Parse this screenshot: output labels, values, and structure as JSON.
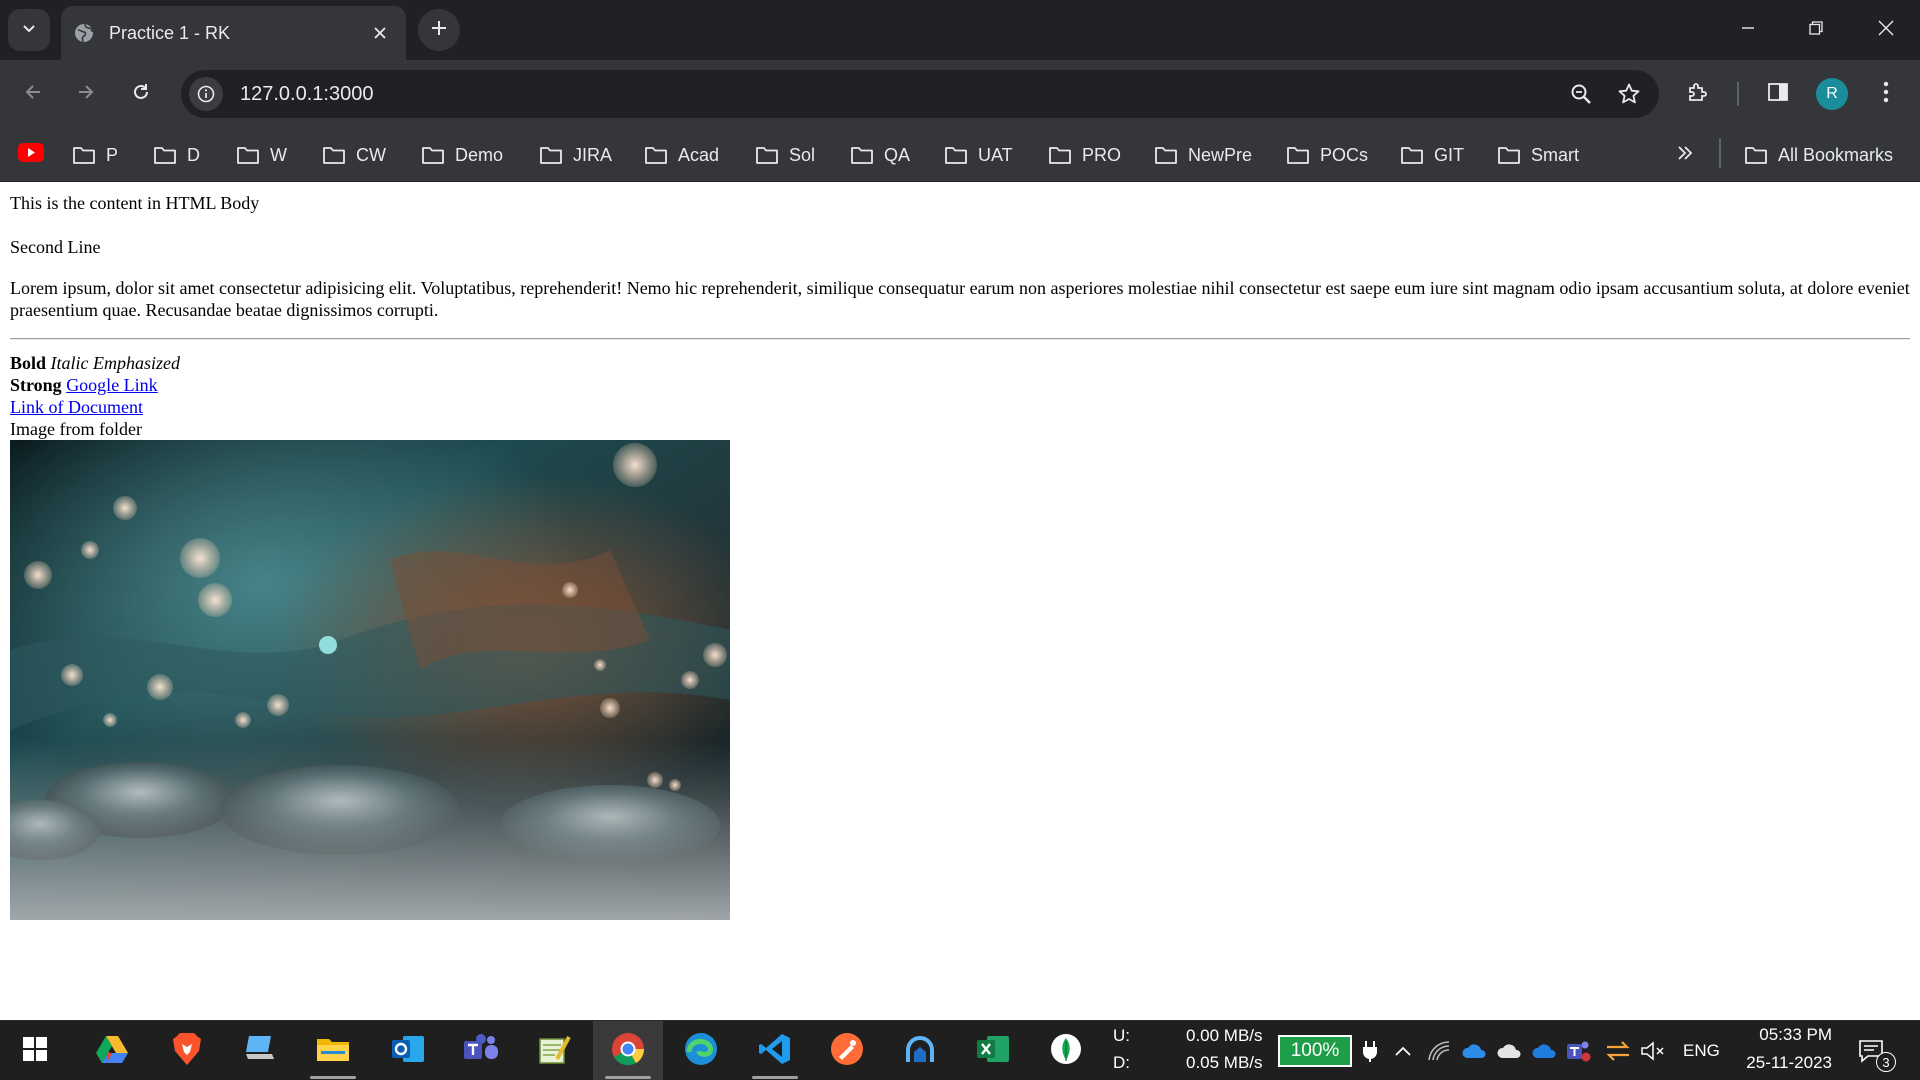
{
  "browser": {
    "tab": {
      "title": "Practice 1 - RK",
      "favicon": "globe-icon"
    },
    "address_bar": {
      "url": "127.0.0.1:3000"
    },
    "profile_initial": "R",
    "bookmarks": [
      {
        "label": "P"
      },
      {
        "label": "D"
      },
      {
        "label": "W"
      },
      {
        "label": "CW"
      },
      {
        "label": "Demo"
      },
      {
        "label": "JIRA"
      },
      {
        "label": "Acad"
      },
      {
        "label": "Sol"
      },
      {
        "label": "QA"
      },
      {
        "label": "UAT"
      },
      {
        "label": "PRO"
      },
      {
        "label": "NewPre"
      },
      {
        "label": "POCs"
      },
      {
        "label": "GIT"
      },
      {
        "label": "Smart"
      }
    ],
    "all_bookmarks_label": "All Bookmarks"
  },
  "page": {
    "line1": "This is the content in HTML Body",
    "line2": "Second Line",
    "lorem": "Lorem ipsum, dolor sit amet consectetur adipisicing elit. Voluptatibus, reprehenderit! Nemo hic reprehenderit, similique consequatur earum non asperiores molestiae nihil consectetur est saepe eum iure sint magnam odio ipsam accusantium soluta, at dolore eveniet praesentium quae. Recusandae beatae dignissimos corrupti.",
    "bold_text": "Bold",
    "italic_text": "Italic",
    "emphasized_text": "Emphasized",
    "strong_text": "Strong",
    "google_link": "Google Link",
    "document_link": "Link of Document",
    "image_alt": "Image from folder"
  },
  "taskbar": {
    "apps": [
      "windows-start",
      "google-drive",
      "brave",
      "computer",
      "file-explorer",
      "outlook",
      "teams",
      "notepad-plus-plus",
      "chrome",
      "edge",
      "vs-code",
      "postman",
      "cloud-app",
      "excel",
      "mongodb-compass"
    ],
    "active_app": "chrome",
    "network_upload_label": "U:",
    "network_download_label": "D:",
    "network_upload": "0.00 MB/s",
    "network_download": "0.05 MB/s",
    "battery": "100%",
    "language": "ENG",
    "time": "05:33 PM",
    "date": "25-11-2023",
    "notification_count": "3"
  },
  "colors": {
    "accent_link": "#0000ee",
    "battery_green": "#1e9e48",
    "chrome_dark": "#202124",
    "chrome_toolbar": "#35363a"
  }
}
